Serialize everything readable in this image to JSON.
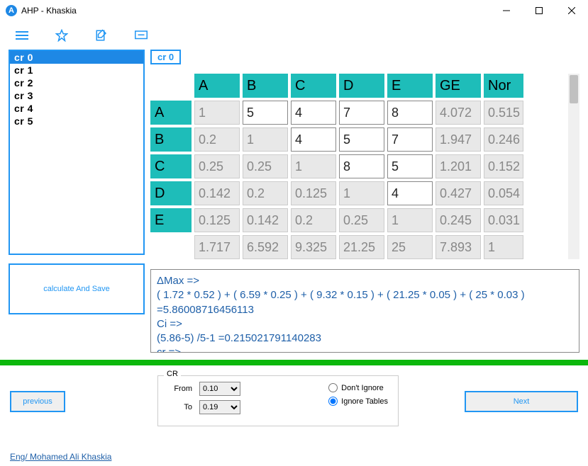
{
  "window": {
    "title": "AHP - Khaskia"
  },
  "sidebar": {
    "items": [
      {
        "label": "cr 0",
        "selected": true
      },
      {
        "label": "cr 1",
        "selected": false
      },
      {
        "label": "cr 2",
        "selected": false
      },
      {
        "label": "cr 3",
        "selected": false
      },
      {
        "label": "cr 4",
        "selected": false
      },
      {
        "label": "cr 5",
        "selected": false
      }
    ],
    "calc_button": "calculate And Save"
  },
  "badge": "cr 0",
  "matrix": {
    "col_headers": [
      "A",
      "B",
      "C",
      "D",
      "E",
      "GE",
      "Nor"
    ],
    "row_headers": [
      "A",
      "B",
      "C",
      "D",
      "E"
    ],
    "rows": [
      {
        "cells": [
          {
            "v": "1",
            "ro": true
          },
          {
            "v": "5"
          },
          {
            "v": "4"
          },
          {
            "v": "7"
          },
          {
            "v": "8"
          },
          {
            "v": "4.072",
            "ro": true
          },
          {
            "v": "0.515",
            "ro": true
          }
        ]
      },
      {
        "cells": [
          {
            "v": "0.2",
            "ro": true
          },
          {
            "v": "1",
            "ro": true
          },
          {
            "v": "4"
          },
          {
            "v": "5"
          },
          {
            "v": "7"
          },
          {
            "v": "1.947",
            "ro": true
          },
          {
            "v": "0.246",
            "ro": true
          }
        ]
      },
      {
        "cells": [
          {
            "v": "0.25",
            "ro": true
          },
          {
            "v": "0.25",
            "ro": true
          },
          {
            "v": "1",
            "ro": true
          },
          {
            "v": "8"
          },
          {
            "v": "5"
          },
          {
            "v": "1.201",
            "ro": true
          },
          {
            "v": "0.152",
            "ro": true
          }
        ]
      },
      {
        "cells": [
          {
            "v": "0.142",
            "ro": true
          },
          {
            "v": "0.2",
            "ro": true
          },
          {
            "v": "0.125",
            "ro": true
          },
          {
            "v": "1",
            "ro": true
          },
          {
            "v": "4"
          },
          {
            "v": "0.427",
            "ro": true
          },
          {
            "v": "0.054",
            "ro": true
          }
        ]
      },
      {
        "cells": [
          {
            "v": "0.125",
            "ro": true
          },
          {
            "v": "0.142",
            "ro": true
          },
          {
            "v": "0.2",
            "ro": true
          },
          {
            "v": "0.25",
            "ro": true
          },
          {
            "v": "1",
            "ro": true
          },
          {
            "v": "0.245",
            "ro": true
          },
          {
            "v": "0.031",
            "ro": true
          }
        ]
      }
    ],
    "sum_row": [
      "1.717",
      "6.592",
      "9.325",
      "21.25",
      "25",
      "7.893",
      "1"
    ]
  },
  "calc": {
    "l1": "ΔMax =>",
    "l2": "( 1.72 * 0.52 )  + ( 6.59 * 0.25 )  + ( 9.32 * 0.15 )  + ( 21.25 * 0.05 )  + ( 25 * 0.03 )  =5.86008716456113",
    "l3": "Ci =>",
    "l4": "(5.86-5) /5-1 =0.215021791140283",
    "l5": "cr =>"
  },
  "cr_group": {
    "legend": "CR",
    "from_label": "From",
    "from_value": "0.10",
    "to_label": "To",
    "to_value": "0.19",
    "radio_dont": "Don't Ignore",
    "radio_ignore": "Ignore Tables"
  },
  "nav": {
    "prev": "previous",
    "next": "Next"
  },
  "footer": "Eng/ Mohamed Ali Khaskia"
}
